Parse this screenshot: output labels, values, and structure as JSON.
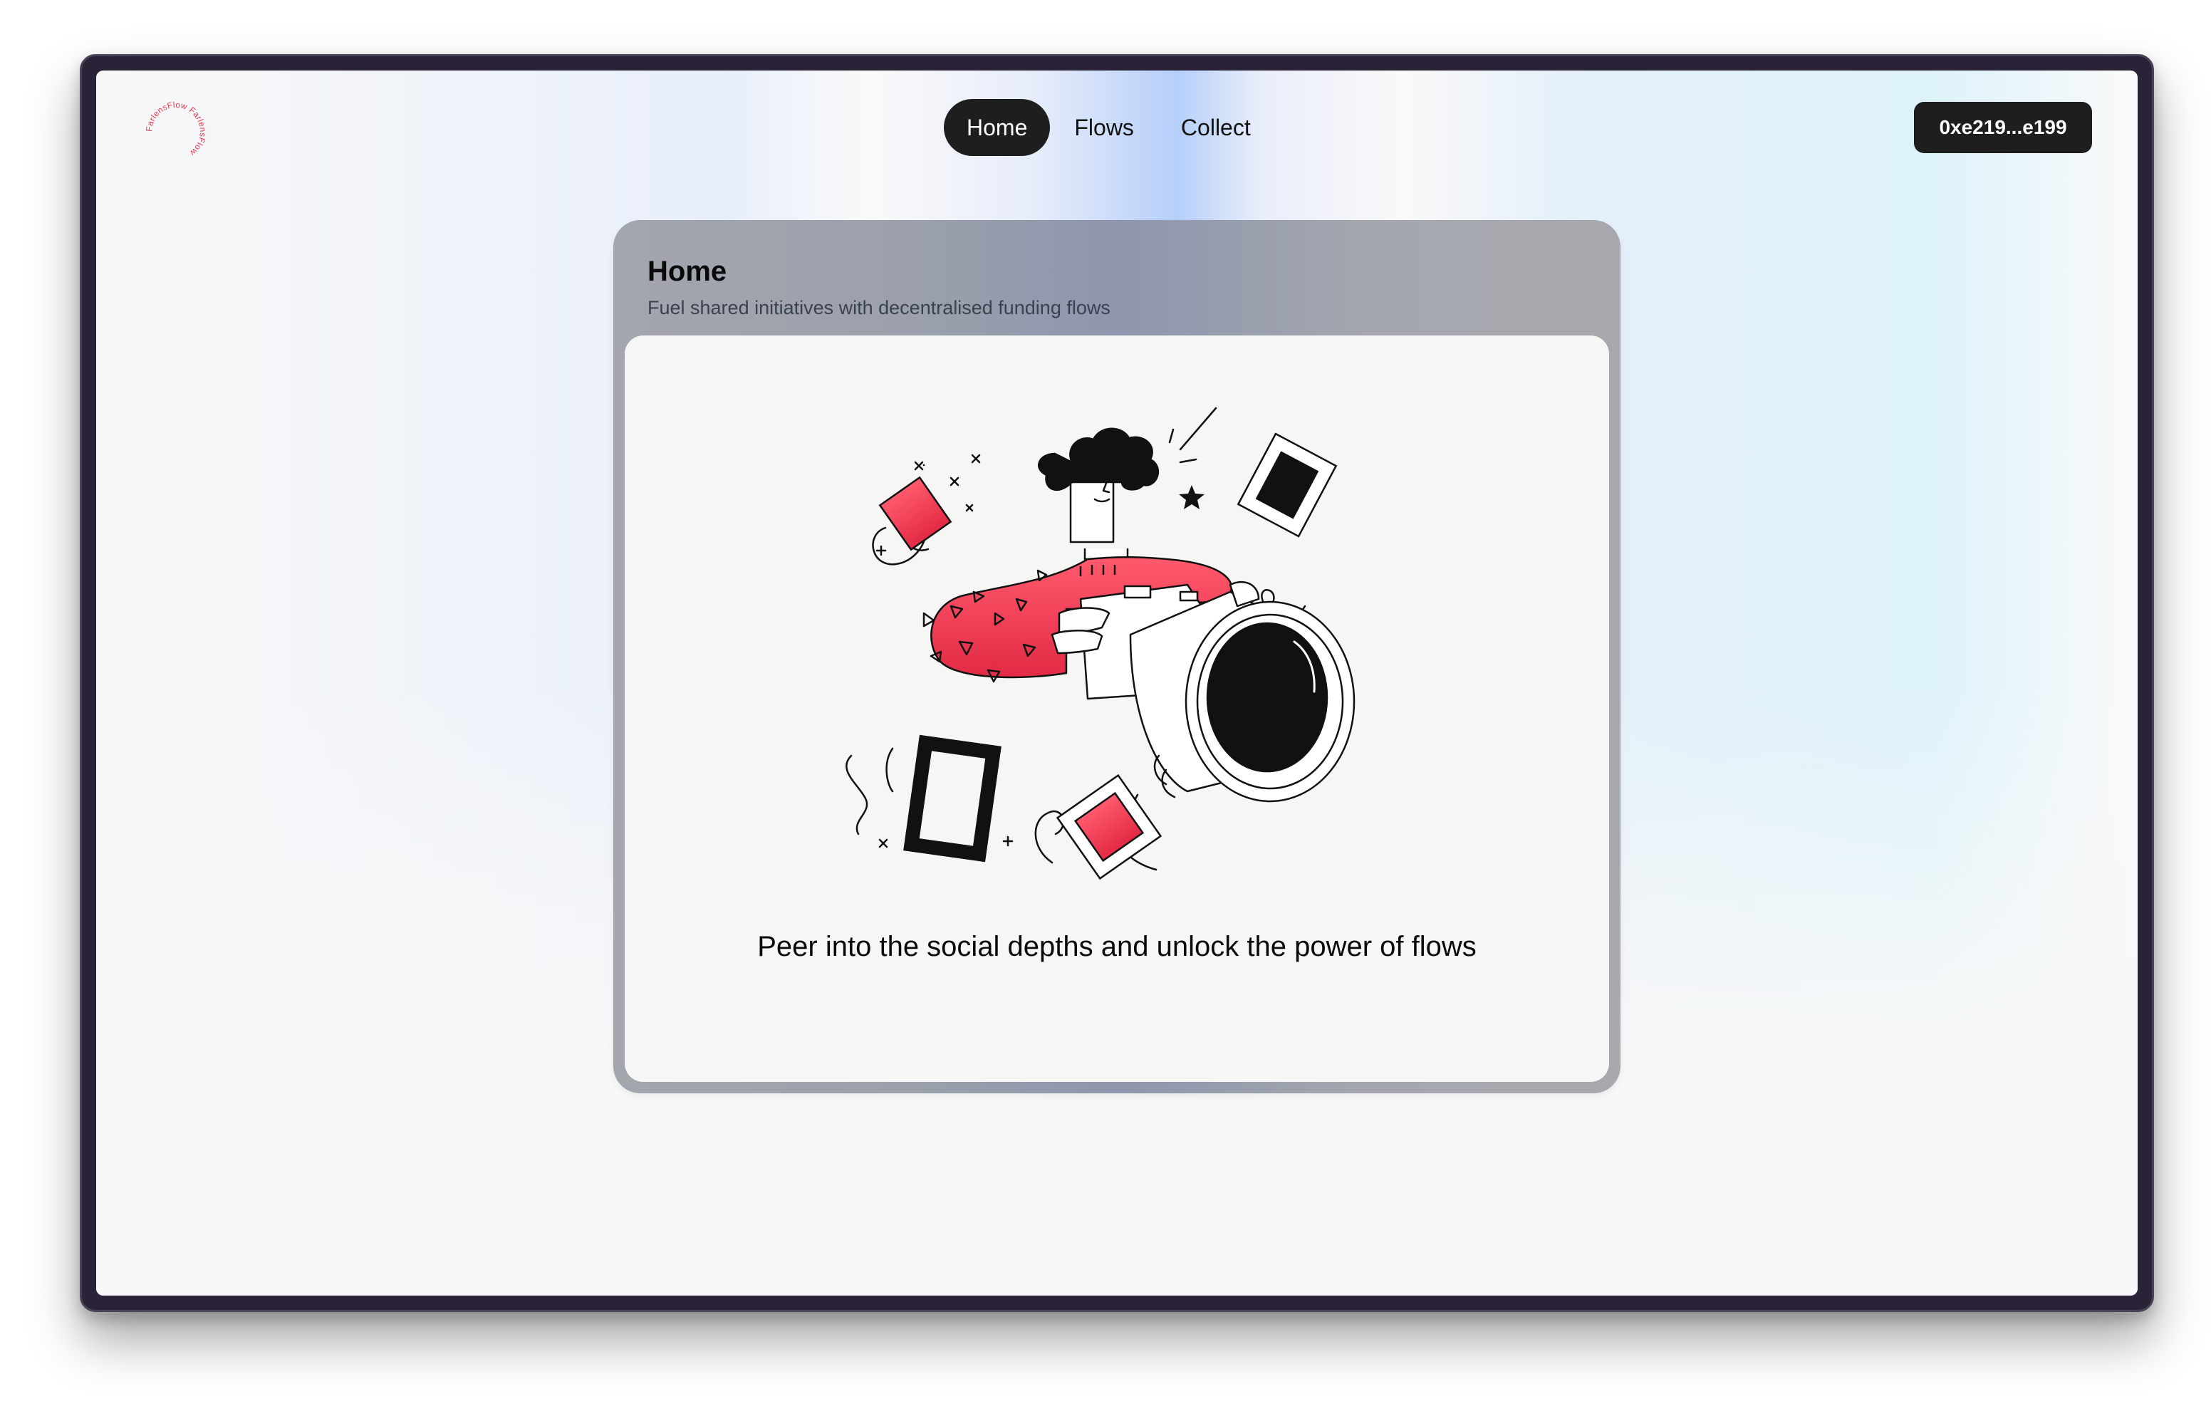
{
  "app": {
    "logo_text": "FarlensFlow FarlensFlow ",
    "logo_color": "#e8304a"
  },
  "nav": {
    "items": [
      {
        "label": "Home",
        "active": true
      },
      {
        "label": "Flows",
        "active": false
      },
      {
        "label": "Collect",
        "active": false
      }
    ]
  },
  "wallet": {
    "address": "0xe219...e199"
  },
  "card": {
    "title": "Home",
    "subtitle": "Fuel shared initiatives with decentralised funding flows",
    "tagline": "Peer into the social depths and unlock the power of flows",
    "illustration_icon": "photographer-illustration"
  },
  "colors": {
    "accent": "#e8304a",
    "dark": "#1e1e1e"
  }
}
